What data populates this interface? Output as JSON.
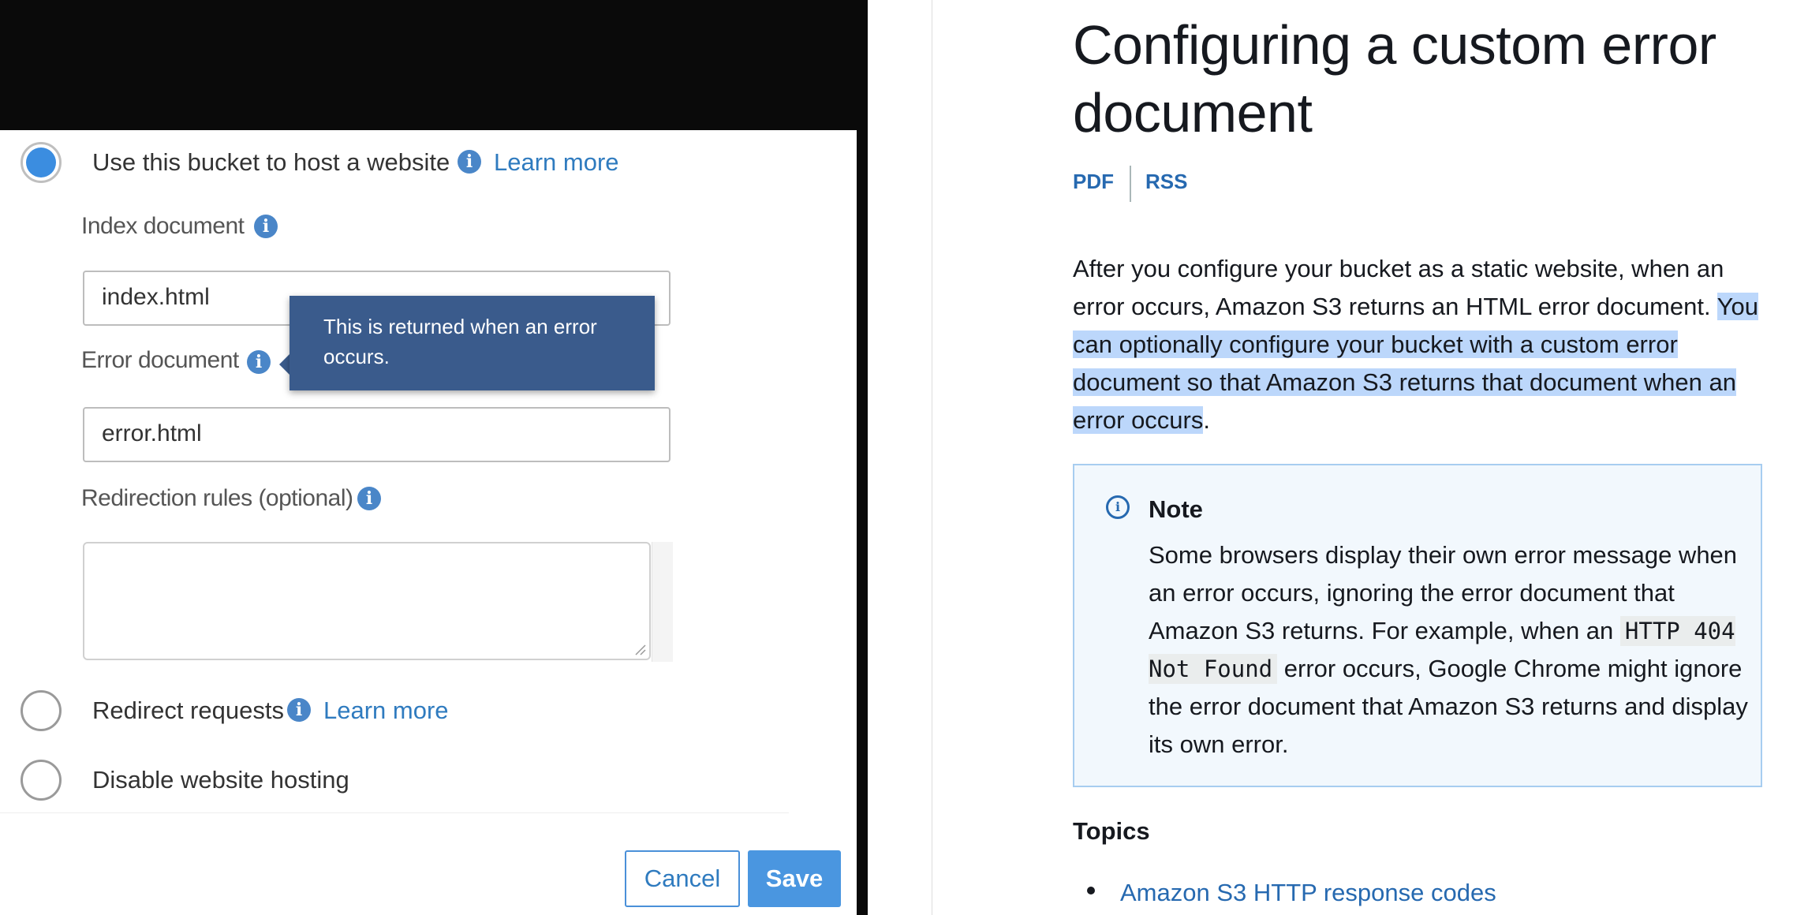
{
  "hosting_panel": {
    "option_host": "Use this bucket to host a website",
    "learn_more": "Learn more",
    "index_label": "Index document",
    "index_value": "index.html",
    "tooltip": "This is returned when an error occurs.",
    "error_label": "Error document",
    "error_value": "error.html",
    "redirection_label": "Redirection rules (optional)",
    "option_redirect": "Redirect requests",
    "option_disable": "Disable website hosting",
    "cancel": "Cancel",
    "save": "Save",
    "selected_option": "Use this bucket to host a website"
  },
  "doc": {
    "title": "Configuring a custom error document",
    "pdf": "PDF",
    "rss": "RSS",
    "para_1": "After you configure your bucket as a static website, when an error occurs, Amazon S3 returns an HTML error document. ",
    "para_highlight": "You can optionally configure your bucket with a custom error document so that Amazon S3 returns that document when an error occurs",
    "para_end": ".",
    "note_title": "Note",
    "note_text_1": "Some browsers display their own error message when an error occurs, ignoring the error document that Amazon S3 returns. For example, when an ",
    "note_code": "HTTP 404 Not Found",
    "note_text_2": " error occurs, Google Chrome might ignore the error document that Amazon S3 returns and display its own error.",
    "topics_heading": "Topics",
    "topic_1": "Amazon S3 HTTP response codes"
  }
}
